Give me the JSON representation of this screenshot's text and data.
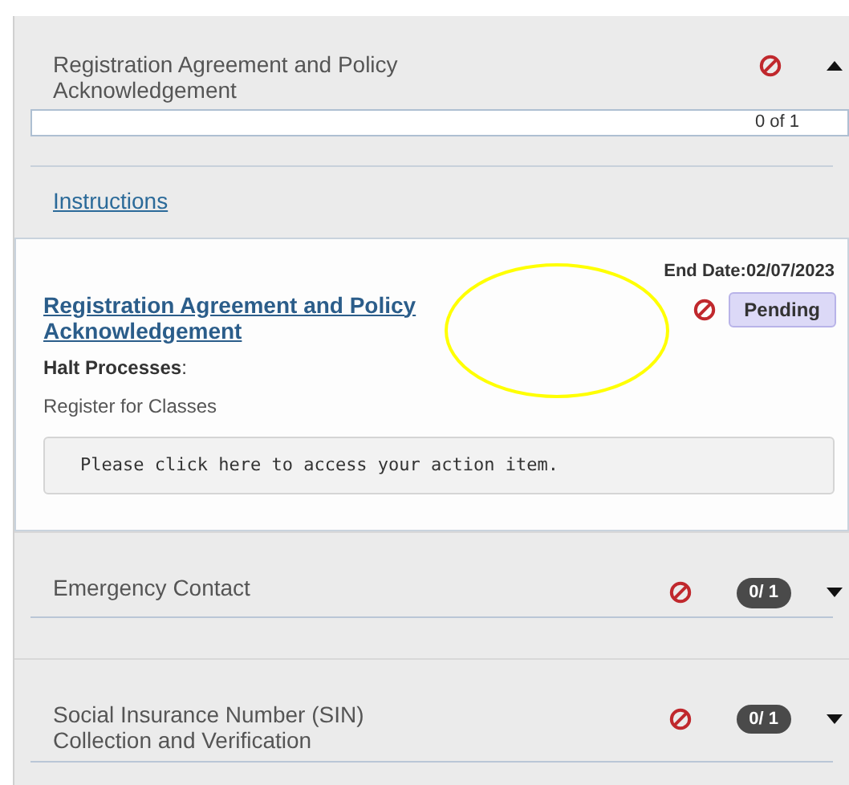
{
  "sections": [
    {
      "title": "Registration Agreement and Policy Acknowledgement",
      "blocked": true,
      "expanded": true,
      "progress": {
        "text": "0 of 1",
        "level": 0
      },
      "instructions_link": "Instructions",
      "items": [
        {
          "end_date": "End Date:02/07/2023",
          "title": "Registration Agreement and Policy Acknowledgement",
          "blocked": true,
          "status": "Pending",
          "halt_label": "Halt Processes",
          "halt_suffix": ":",
          "halt_process": "Register for Classes",
          "action_text": "Please click here to access your action item."
        }
      ]
    },
    {
      "title": "Emergency Contact",
      "blocked": true,
      "expanded": false,
      "count": "0/ 1"
    },
    {
      "title": "Social Insurance Number (SIN) Collection and Verification",
      "blocked": true,
      "expanded": false,
      "count": "0/ 1"
    }
  ],
  "annotation": {
    "kind": "ellipse",
    "color": "#ffff00"
  }
}
